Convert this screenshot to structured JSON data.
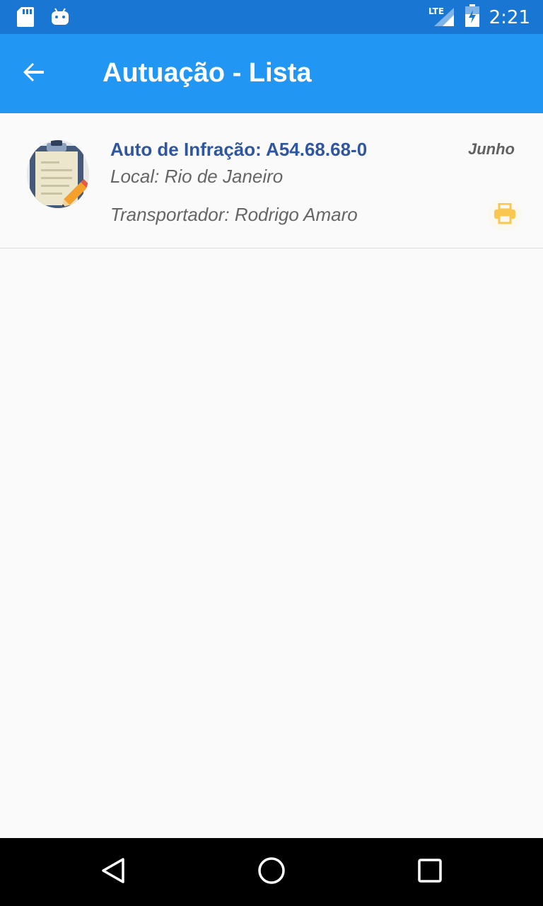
{
  "status_bar": {
    "network_label": "LTE",
    "time": "2:21",
    "icons": [
      "sd-card-icon",
      "android-icon",
      "lte-signal-icon",
      "battery-icon"
    ]
  },
  "app_bar": {
    "back_icon": "arrow-left-icon",
    "title": "Autuação - Lista"
  },
  "list": {
    "items": [
      {
        "avatar_icon": "clipboard-pencil-icon",
        "title": "Auto de Infração: A54.68.68-0",
        "date": "Junho",
        "local": "Local: Rio de Janeiro",
        "transportador": "Transportador: Rodrigo Amaro",
        "action_icon": "printer-icon"
      }
    ]
  },
  "nav_bar": {
    "icons": [
      "back-triangle-icon",
      "home-circle-icon",
      "recents-square-icon"
    ]
  },
  "colors": {
    "status_bar": "#1976d2",
    "app_bar": "#2196f3",
    "title_text": "#2f56a0",
    "print_icon": "#f9c74f",
    "background": "#fafafa"
  }
}
